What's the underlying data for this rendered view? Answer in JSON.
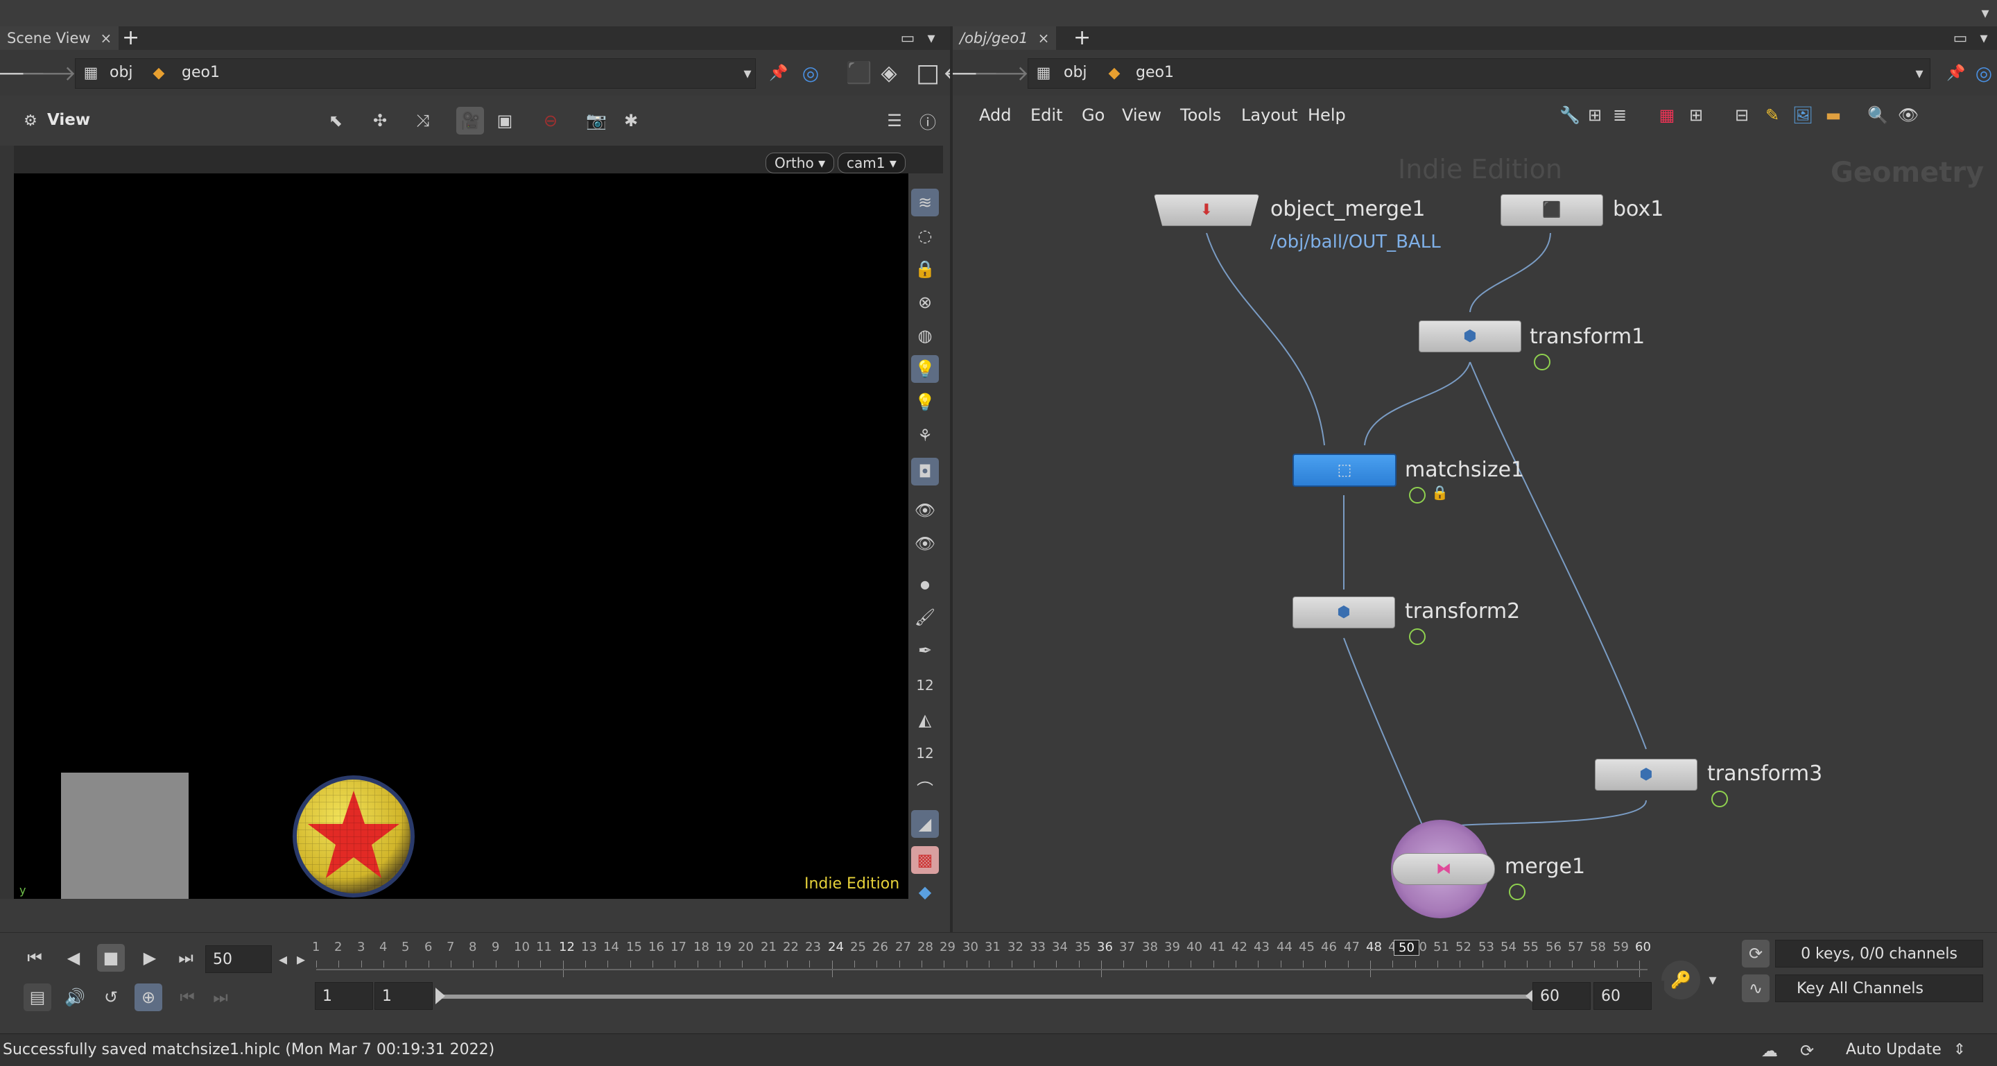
{
  "left_panel": {
    "tab_label": "Scene View",
    "path": {
      "root": "obj",
      "current": "geo1"
    },
    "view_label": "View",
    "viewport": {
      "projection": "Ortho",
      "camera": "cam1",
      "watermark": "Indie Edition",
      "axis_label": "y"
    }
  },
  "right_panel": {
    "tab_label": "/obj/geo1",
    "path": {
      "root": "obj",
      "current": "geo1"
    },
    "menu": [
      "Add",
      "Edit",
      "Go",
      "View",
      "Tools",
      "Layout",
      "Help"
    ],
    "watermark": "Indie Edition",
    "context_label": "Geometry",
    "nodes": {
      "object_merge1": {
        "name": "object_merge1",
        "subtitle": "/obj/ball/OUT_BALL"
      },
      "box1": {
        "name": "box1"
      },
      "transform1": {
        "name": "transform1"
      },
      "matchsize1": {
        "name": "matchsize1"
      },
      "transform2": {
        "name": "transform2"
      },
      "transform3": {
        "name": "transform3"
      },
      "merge1": {
        "name": "merge1"
      }
    }
  },
  "timeline": {
    "current_frame": "50",
    "ticks": [
      "1",
      "2",
      "3",
      "4",
      "5",
      "6",
      "7",
      "8",
      "9",
      "10",
      "11",
      "12",
      "13",
      "14",
      "15",
      "16",
      "17",
      "18",
      "19",
      "20",
      "21",
      "22",
      "23",
      "24",
      "25",
      "26",
      "27",
      "28",
      "29",
      "30",
      "31",
      "32",
      "33",
      "34",
      "35",
      "36",
      "37",
      "38",
      "39",
      "40",
      "41",
      "42",
      "43",
      "44",
      "45",
      "46",
      "47",
      "48",
      "49",
      "50",
      "51",
      "52",
      "53",
      "54",
      "55",
      "56",
      "57",
      "58",
      "59",
      "60"
    ],
    "playhead": "50",
    "range_start": "1",
    "range_start2": "1",
    "range_end": "60",
    "range_end2": "60",
    "keys_info": "0 keys, 0/0 channels",
    "key_channels_label": "Key All Channels"
  },
  "status": {
    "message": "Successfully saved matchsize1.hiplc (Mon Mar  7 00:19:31 2022)",
    "auto_update": "Auto Update"
  },
  "colors": {
    "selected_node": "#3d8fe6",
    "wire": "#7a9cc4",
    "watermark_viewport": "#e6d23a",
    "subtitle": "#7fb0e8"
  }
}
